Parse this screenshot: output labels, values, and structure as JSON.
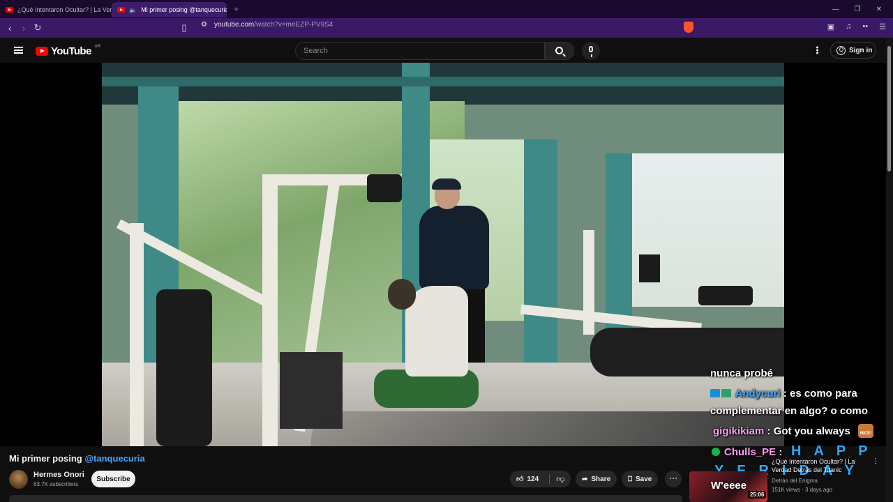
{
  "browser": {
    "tabs": [
      {
        "title": "¿Qué Intentaron Ocultar? | La Verdad",
        "active": false
      },
      {
        "title": "Mi primer posing @tanquecuria",
        "active": true
      }
    ],
    "address": {
      "host": "youtube.com",
      "path": "/watch?v=meEZP-PV9S4"
    },
    "accent": "#3a1a66"
  },
  "masthead": {
    "logo_text": "YouTube",
    "country": "AR",
    "search_placeholder": "Search",
    "signin_label": "Sign in"
  },
  "chat": {
    "line1": "nunca probé",
    "msg2_user": "Andycuri",
    "msg2_text": " : es como para",
    "line3": "complementar en algo? o como",
    "msg4_user": "gigikikiam",
    "msg4_text": " : Got you always",
    "msg5_user": "Chulls_PE",
    "msg5_sep": " :",
    "happy": "HAPP",
    "friday": "YFRIDAY",
    "last_line": "W'eeee",
    "emote_label": "NICE!"
  },
  "video": {
    "title_prefix": "Mi primer posing ",
    "title_mention": "@tanquecuria",
    "channel": "Hermes Onori",
    "subscribers": "63.7K subscribers",
    "subscribe_label": "Subscribe",
    "likes": "124",
    "share_label": "Share",
    "save_label": "Save"
  },
  "recommended": {
    "title": "¿Qué Intentaron Ocultar? | La Verdad Detrás del Titanic",
    "channel": "Detrás del Enigma",
    "meta": "151K views · 3 days ago",
    "duration": "25:06"
  },
  "icons": [
    "hamburger-icon",
    "youtube-logo-icon",
    "search-icon",
    "mic-icon",
    "more-vert-icon",
    "user-icon",
    "like-icon",
    "dislike-icon",
    "share-icon",
    "save-icon"
  ]
}
